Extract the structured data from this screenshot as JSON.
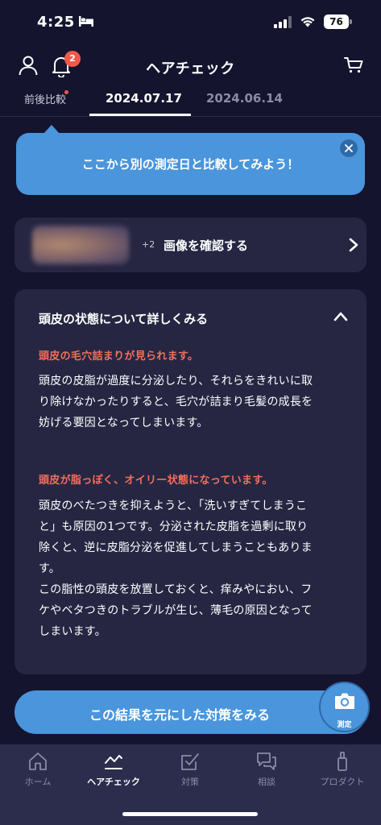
{
  "status_bar": {
    "time": "4:25",
    "battery": "76"
  },
  "header": {
    "title": "ヘアチェック",
    "notification_count": "2"
  },
  "tabs": [
    {
      "label": "前後比較"
    },
    {
      "label": "2024.07.17",
      "active": true
    },
    {
      "label": "2024.06.14"
    }
  ],
  "tooltip": {
    "text": "ここから別の測定日と比較してみよう！"
  },
  "image_card": {
    "count": "+2",
    "label": "画像を確認する"
  },
  "detail": {
    "title": "頭皮の状態について詳しくみる",
    "findings": [
      {
        "heading": "頭皮の毛穴詰まりが見られます。",
        "lines": [
          "頭皮の皮脂が過度に分泌したり、それらをきれいに取",
          "り除けなかったりすると、毛穴が詰まり毛髪の成長を",
          "妨げる要因となってしまいます。"
        ]
      },
      {
        "heading": "頭皮が脂っぽく、オイリー状態になっています。",
        "lines": [
          "頭皮のべたつきを抑えようと、「洗いすぎてしまうこ",
          "と」も原因の1つです。分泌された皮脂を過剰に取り",
          "除くと、逆に皮脂分泌を促進してしまうこともありま",
          "す。",
          "この脂性の頭皮を放置しておくと、痒みやにおい、フ",
          "ケやベタつきのトラブルが生じ、薄毛の原因となって",
          "しまいます。"
        ]
      }
    ]
  },
  "cta": {
    "label": "この結果を元にした対策をみる"
  },
  "fab": {
    "label": "測定"
  },
  "bottom_nav": [
    {
      "label": "ホーム",
      "icon": "home-icon"
    },
    {
      "label": "ヘアチェック",
      "icon": "hair-check-icon",
      "active": true
    },
    {
      "label": "対策",
      "icon": "checklist-icon"
    },
    {
      "label": "相談",
      "icon": "chat-icon"
    },
    {
      "label": "プロダクト",
      "icon": "product-icon"
    }
  ],
  "colors": {
    "background": "#15142f",
    "card": "#262643",
    "accent": "#4a95dc",
    "alert": "#f05a4a",
    "finding_heading": "#f0705a"
  }
}
